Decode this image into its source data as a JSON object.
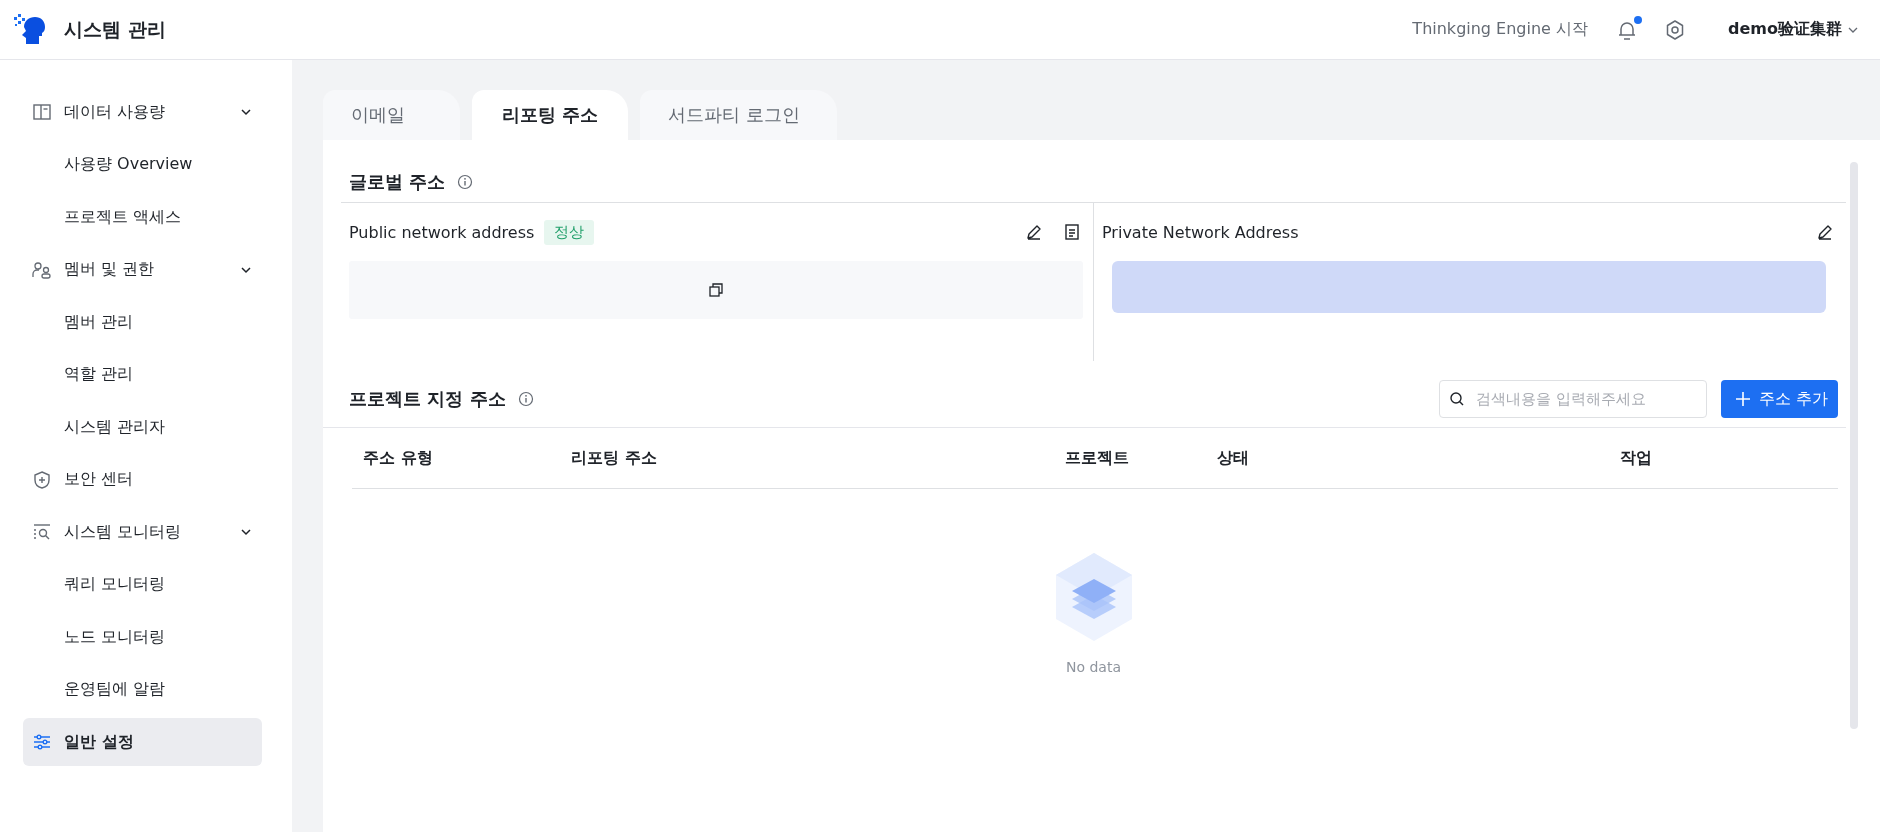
{
  "header": {
    "title": "시스템 관리",
    "start_link": "Thinkging Engine 시작",
    "notifications": {
      "unread": true
    },
    "cluster": "demo验证集群"
  },
  "sidebar": {
    "items": [
      {
        "label": "데이터 사용량",
        "expanded": true,
        "selected": false,
        "children": [
          {
            "label": "사용량 Overview",
            "selected": false
          },
          {
            "label": "프로젝트 액세스",
            "selected": false
          }
        ]
      },
      {
        "label": "멤버 및 권한",
        "expanded": true,
        "selected": false,
        "children": [
          {
            "label": "멤버 관리",
            "selected": false
          },
          {
            "label": "역할 관리",
            "selected": false
          },
          {
            "label": "시스템 관리자",
            "selected": false
          }
        ]
      },
      {
        "label": "보안 센터",
        "selected": false
      },
      {
        "label": "시스템 모니터링",
        "expanded": true,
        "selected": false,
        "children": [
          {
            "label": "쿼리 모니터링",
            "selected": false
          },
          {
            "label": "노드 모니터링",
            "selected": false
          },
          {
            "label": "운영팀에 알람",
            "selected": false
          }
        ]
      },
      {
        "label": "일반 설정",
        "selected": true
      }
    ]
  },
  "tabs": [
    {
      "label": "이메일",
      "selected": false
    },
    {
      "label": "리포팅 주소",
      "selected": true
    },
    {
      "label": "서드파티 로그인",
      "selected": false
    }
  ],
  "global_address": {
    "title": "글로벌 주소",
    "public": {
      "title": "Public network address",
      "status": "정상"
    },
    "private": {
      "title": "Private Network Address"
    }
  },
  "project_address": {
    "title": "프로젝트 지정 주소",
    "search": {
      "placeholder": "검색내용을 입력해주세요"
    },
    "add_button": "주소 추가",
    "table": {
      "columns": [
        "주소 유형",
        "리포팅 주소",
        "프로젝트",
        "상태",
        "작업"
      ],
      "empty_text": "No data"
    }
  }
}
